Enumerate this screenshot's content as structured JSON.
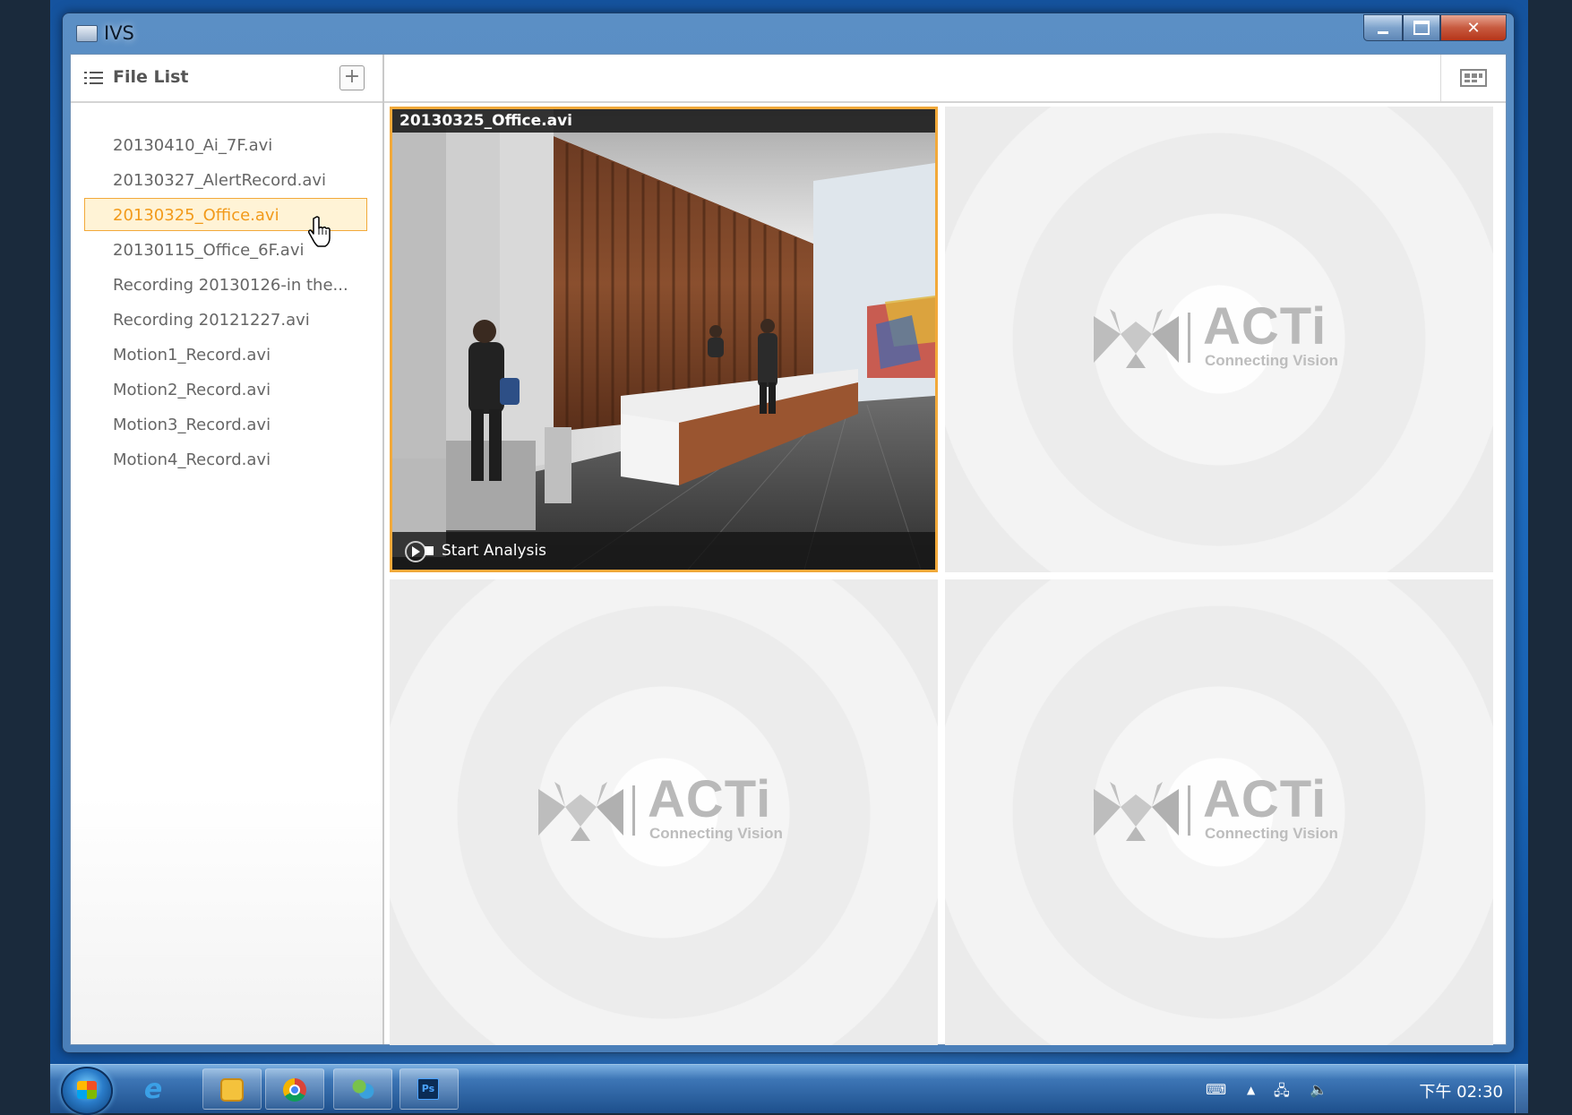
{
  "window": {
    "title": "IVS"
  },
  "sidebar": {
    "title": "File List",
    "add_label": "+",
    "files": [
      {
        "label": "20130410_Ai_7F.avi"
      },
      {
        "label": "20130327_AlertRecord.avi"
      },
      {
        "label": "20130325_Office.avi",
        "selected": true
      },
      {
        "label": "20130115_Office_6F.avi"
      },
      {
        "label": "Recording 20130126-in the..."
      },
      {
        "label": "Recording 20121227.avi"
      },
      {
        "label": "Motion1_Record.avi"
      },
      {
        "label": "Motion2_Record.avi"
      },
      {
        "label": "Motion3_Record.avi"
      },
      {
        "label": "Motion4_Record.avi"
      }
    ]
  },
  "viewer": {
    "active_cell": {
      "title": "20130325_Office.avi",
      "action_label": "Start Analysis"
    },
    "placeholder": {
      "brand": "ACTi",
      "tagline": "Connecting Vision"
    }
  },
  "taskbar": {
    "apps": [
      "ie-icon",
      "outlook-icon",
      "chrome-icon",
      "people-icon",
      "photoshop-icon"
    ],
    "photoshop_label": "Ps",
    "clock": "下午 02:30"
  },
  "colors": {
    "selection_border": "#f2a93a",
    "selection_text": "#f29a1a",
    "selection_bg": "#fff3d6"
  }
}
